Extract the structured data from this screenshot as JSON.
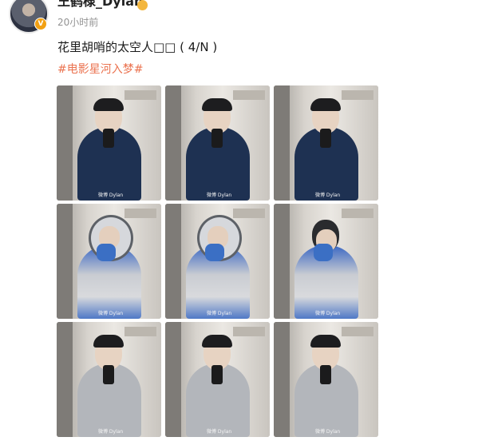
{
  "header": {
    "username": "王鹤棣_Dylan",
    "timestamp": "20小时前",
    "verified_badge": "V"
  },
  "post": {
    "text": "花里胡哨的太空人□□ ( 4/N )",
    "hashtag": "#电影星河入梦#"
  },
  "photos": [
    {
      "outfit": "navy-uniform",
      "watermark": "微博 Dylan"
    },
    {
      "outfit": "navy-uniform",
      "watermark": "微博 Dylan"
    },
    {
      "outfit": "navy-uniform",
      "watermark": "微博 Dylan"
    },
    {
      "outfit": "space-suit-helmet",
      "watermark": "微博 Dylan"
    },
    {
      "outfit": "space-suit-helmet",
      "watermark": "微博 Dylan"
    },
    {
      "outfit": "space-suit-hood",
      "watermark": "微博 Dylan"
    },
    {
      "outfit": "grey-bodysuit",
      "watermark": "微博 Dylan"
    },
    {
      "outfit": "grey-bodysuit",
      "watermark": "微博 Dylan"
    },
    {
      "outfit": "grey-bodysuit",
      "watermark": "微博 Dylan"
    }
  ],
  "colors": {
    "hashtag": "#eb7350",
    "timestamp": "#939393",
    "verified": "#f2a012"
  }
}
